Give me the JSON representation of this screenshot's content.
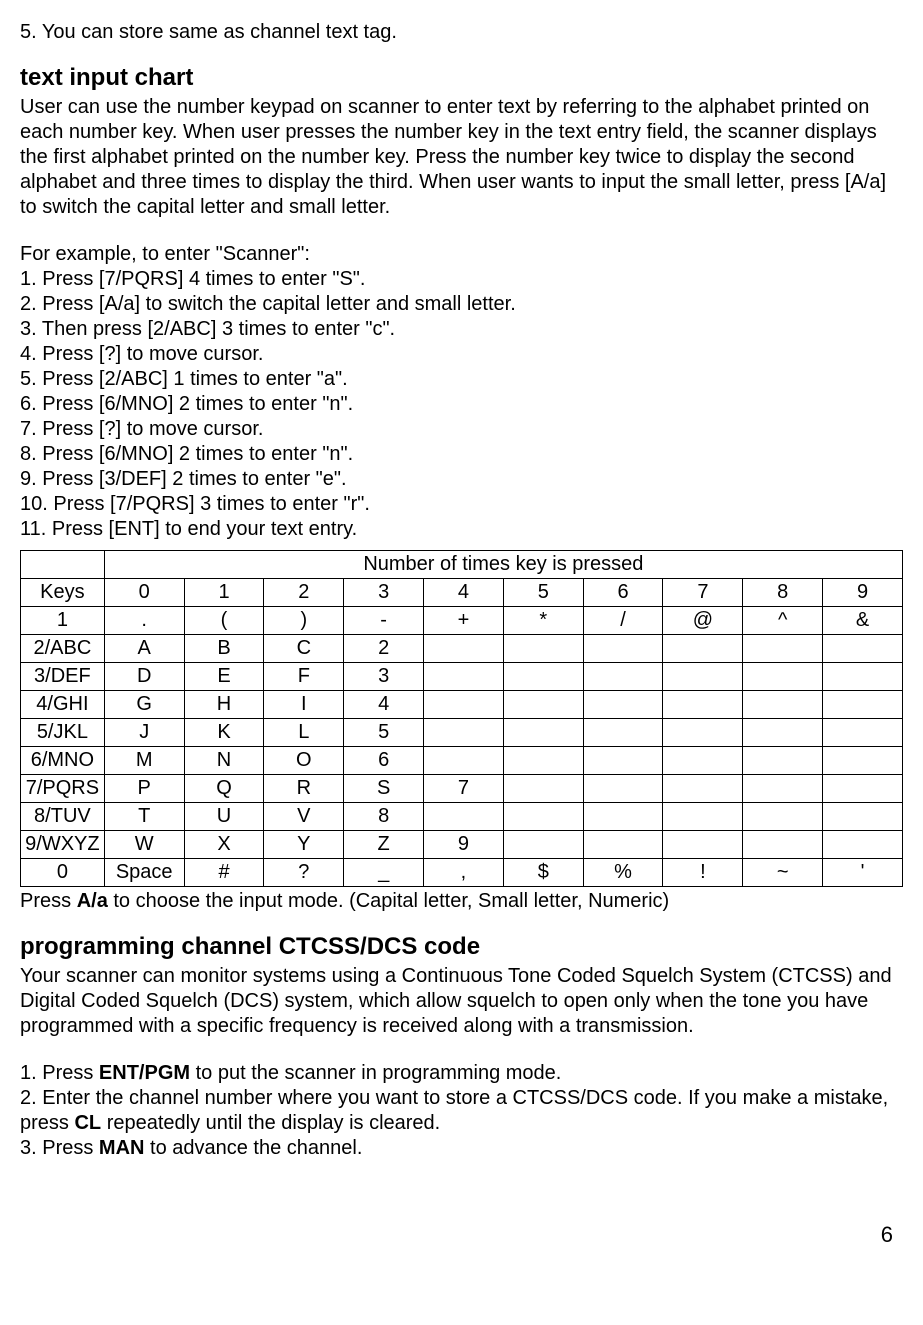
{
  "intro": {
    "line1": "5. You can store same as channel text tag."
  },
  "heading1": "text input chart",
  "chart_intro": {
    "p1": "User can use the number keypad on scanner to enter text by referring to the alphabet printed on each number key. When user presses the number key in the text entry field, the scanner displays the first alphabet printed on the number key. Press the number key twice to display the second alphabet and three times to display the third. When user wants to input the small letter, press [A/a] to switch the capital letter and small letter."
  },
  "example": {
    "intro": "For example, to enter \"Scanner\":",
    "steps": [
      "1. Press [7/PQRS] 4 times to enter \"S\".",
      "2. Press [A/a] to switch the capital letter and small letter.",
      "3. Then press [2/ABC] 3 times to enter \"c\".",
      "4. Press [?] to move cursor.",
      "5. Press [2/ABC] 1 times to enter \"a\".",
      "6. Press [6/MNO] 2 times to enter \"n\".",
      "7. Press [?] to move cursor.",
      "8. Press [6/MNO] 2 times to enter \"n\".",
      "9. Press [3/DEF] 2 times to enter \"e\".",
      "10. Press [7/PQRS] 3 times to enter \"r\".",
      "11. Press [ENT] to end your text entry."
    ]
  },
  "chart_data": {
    "type": "table",
    "title": "Number of times key is pressed",
    "headers": [
      "Keys",
      "0",
      "1",
      "2",
      "3",
      "4",
      "5",
      "6",
      "7",
      "8",
      "9"
    ],
    "rows": [
      {
        "key": "1",
        "cells": [
          ".",
          "(",
          ")",
          "-",
          "+",
          "*",
          "/",
          "@",
          "^",
          "&"
        ]
      },
      {
        "key": "2/ABC",
        "cells": [
          "A",
          "B",
          "C",
          "2",
          "",
          "",
          "",
          "",
          "",
          ""
        ]
      },
      {
        "key": "3/DEF",
        "cells": [
          "D",
          "E",
          "F",
          "3",
          "",
          "",
          "",
          "",
          "",
          ""
        ]
      },
      {
        "key": "4/GHI",
        "cells": [
          "G",
          "H",
          "I",
          "4",
          "",
          "",
          "",
          "",
          "",
          ""
        ]
      },
      {
        "key": "5/JKL",
        "cells": [
          "J",
          "K",
          "L",
          "5",
          "",
          "",
          "",
          "",
          "",
          ""
        ]
      },
      {
        "key": "6/MNO",
        "cells": [
          "M",
          "N",
          "O",
          "6",
          "",
          "",
          "",
          "",
          "",
          ""
        ]
      },
      {
        "key": "7/PQRS",
        "cells": [
          "P",
          "Q",
          "R",
          "S",
          "7",
          "",
          "",
          "",
          "",
          ""
        ]
      },
      {
        "key": "8/TUV",
        "cells": [
          "T",
          "U",
          "V",
          "8",
          "",
          "",
          "",
          "",
          "",
          ""
        ]
      },
      {
        "key": "9/WXYZ",
        "cells": [
          "W",
          "X",
          "Y",
          "Z",
          "9",
          "",
          "",
          "",
          "",
          ""
        ]
      },
      {
        "key": "0",
        "cells": [
          "Space",
          "#",
          "?",
          "_",
          ",",
          "$",
          "%",
          "!",
          "~",
          "'"
        ]
      }
    ]
  },
  "after_table": {
    "prefix": "Press ",
    "bold": "A/a",
    "suffix": " to choose the input mode. (Capital letter, Small letter, Numeric)"
  },
  "heading2": "programming channel CTCSS/DCS code",
  "ctcss_intro": "Your scanner can monitor systems using a Continuous Tone Coded Squelch System (CTCSS) and Digital Coded Squelch (DCS) system, which allow squelch to open only when the tone you have programmed with a specific frequency is received along with a transmission.",
  "ctcss_steps": {
    "s1_prefix": "1. Press ",
    "s1_bold": "ENT/PGM",
    "s1_suffix": " to put the scanner in programming mode.",
    "s2_prefix": "2. Enter the channel number where you want to store a CTCSS/DCS code. If you make a mistake, press ",
    "s2_bold": "CL",
    "s2_suffix": " repeatedly until the display is cleared.",
    "s3_prefix": "3. Press ",
    "s3_bold": "MAN",
    "s3_suffix": " to advance the channel."
  },
  "page": "6"
}
